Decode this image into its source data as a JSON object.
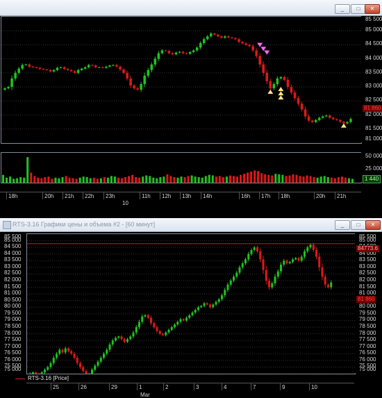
{
  "top_window": {
    "title": "",
    "buttons": [
      "_",
      "□",
      "✕"
    ],
    "price_ticks": [
      "85 500",
      "85 000",
      "84 500",
      "84 000",
      "83 500",
      "83 000",
      "82 500",
      "82 000",
      "81 500",
      "81 000"
    ],
    "price_badge": "81 860",
    "volume_ticks": [
      "50 000",
      "25 000"
    ],
    "volume_badge": "1 440",
    "time_labels": [
      "18h",
      "20h",
      "21h",
      "22h",
      "23h",
      "11h",
      "12h",
      "13h",
      "14h",
      "16h",
      "17h",
      "18h",
      "20h",
      "21h"
    ],
    "date_label": "10"
  },
  "bottom_window": {
    "title": "RTS-3.16 Графики цены и объема #2 - [60 минут]",
    "buttons": [
      "_",
      "□",
      "✕"
    ],
    "price_ticks": [
      "85 500",
      "85 000",
      "84 500",
      "84 000",
      "83 500",
      "83 000",
      "82 500",
      "82 000",
      "81 500",
      "81 000",
      "80 500",
      "80 000",
      "79 500",
      "79 000",
      "78 500",
      "78 000",
      "77 500",
      "77 000",
      "76 500",
      "76 000",
      "75 500",
      "75 000"
    ],
    "badge_high": "84773.6",
    "badge_last": "81 860",
    "legend": "RTS-3.16 [Price]",
    "time_labels": [
      "25",
      "26",
      "29",
      "1",
      "2",
      "3",
      "4",
      "7",
      "9",
      "10"
    ],
    "month_label": "Mar"
  },
  "colors": {
    "up": "#1fc41f",
    "down": "#e01818",
    "grid": "#333333",
    "hline": "#c02020",
    "pink": "#ff66ff",
    "yellow": "#ffe680",
    "badge_bg": "#7a0000"
  },
  "chart_data": [
    {
      "type": "candlestick",
      "title": "",
      "ylim": [
        81000,
        85500
      ],
      "y_ticks": [
        85500,
        85000,
        84500,
        84000,
        83500,
        83000,
        82500,
        82000,
        81500,
        81000
      ],
      "series": [
        {
          "values": [
            82900,
            82950,
            83000,
            83300,
            83500,
            83650,
            83780,
            83800,
            83720,
            83700,
            83680,
            83640,
            83620,
            83600,
            83550,
            83600,
            83680,
            83700,
            83640,
            83600,
            83560,
            83500,
            83600,
            83650,
            83700,
            83780,
            83760,
            83700,
            83700,
            83680,
            83720,
            83760,
            83780,
            83720,
            83620,
            83500,
            83300,
            83050,
            82950,
            82900,
            83100,
            83400,
            83600,
            83800,
            84000,
            84200,
            84300,
            84280,
            84200,
            84160,
            84220,
            84250,
            84200,
            84180,
            84240,
            84300,
            84400,
            84560,
            84700,
            84800,
            84900,
            84860,
            84800,
            84750,
            84800,
            84760,
            84740,
            84700,
            84600,
            84550,
            84500,
            84450,
            84300,
            84100,
            83800,
            83500,
            83200,
            82950,
            83100,
            83300,
            83350,
            83250,
            83000,
            82800,
            82600,
            82400,
            82200,
            81950,
            81800,
            81750,
            81820,
            81900,
            81950,
            81980,
            81900,
            81850,
            81820,
            81760,
            81700,
            81750,
            81860
          ]
        }
      ]
    },
    {
      "type": "bar",
      "title": "",
      "ylim": [
        0,
        50000
      ],
      "y_ticks": [
        50000,
        25000
      ],
      "values": [
        14000,
        9000,
        11000,
        7000,
        8000,
        10000,
        9000,
        46000,
        18000,
        12000,
        9000,
        8000,
        10000,
        11000,
        7000,
        9000,
        8000,
        10000,
        12000,
        9000,
        8000,
        7000,
        9000,
        11000,
        10000,
        8000,
        9000,
        7000,
        8000,
        10000,
        9000,
        12000,
        11000,
        9000,
        8000,
        10000,
        12000,
        14000,
        10000,
        9000,
        11000,
        13000,
        12000,
        9000,
        8000,
        10000,
        11000,
        15000,
        12000,
        10000,
        9000,
        11000,
        10000,
        12000,
        13000,
        11000,
        10000,
        9000,
        12000,
        14000,
        13000,
        11000,
        12000,
        10000,
        11000,
        13000,
        12000,
        11000,
        14000,
        16000,
        18000,
        20000,
        22000,
        21000,
        17000,
        15000,
        14000,
        13000,
        16000,
        15000,
        14000,
        12000,
        13000,
        15000,
        14000,
        12000,
        11000,
        13000,
        12000,
        10000,
        9000,
        11000,
        12000,
        10000,
        9000,
        8000,
        10000,
        11000,
        9000,
        8000,
        7000
      ]
    },
    {
      "type": "candlestick",
      "title": "",
      "ylim": [
        75000,
        85500
      ],
      "y_ticks": [
        85500,
        85000,
        84500,
        84000,
        83500,
        83000,
        82500,
        82000,
        81500,
        81000,
        80500,
        80000,
        79500,
        79000,
        78500,
        78000,
        77500,
        77000,
        76500,
        76000,
        75500,
        75000
      ],
      "hline": 84773.6,
      "series": [
        {
          "name": "RTS-3.16 [Price]",
          "values": [
            74800,
            75000,
            75100,
            75000,
            74900,
            75100,
            75300,
            75500,
            75800,
            76200,
            76500,
            76800,
            76600,
            76900,
            76700,
            76500,
            76200,
            75800,
            75500,
            75200,
            74900,
            75000,
            75300,
            75600,
            75900,
            76200,
            76500,
            76800,
            77200,
            77500,
            77700,
            77800,
            77600,
            77400,
            77600,
            77800,
            78100,
            78500,
            78900,
            79300,
            79400,
            79200,
            78800,
            78500,
            78200,
            78000,
            77900,
            78100,
            78300,
            78500,
            78700,
            78900,
            79100,
            79000,
            79200,
            79400,
            79600,
            79800,
            80000,
            80100,
            80300,
            80200,
            80000,
            80200,
            80400,
            80600,
            80900,
            81300,
            81700,
            82000,
            82300,
            82600,
            83000,
            83300,
            83600,
            84000,
            84300,
            84500,
            84200,
            83600,
            82800,
            82000,
            81500,
            81800,
            82300,
            82700,
            83200,
            83500,
            83300,
            83400,
            83600,
            83700,
            83500,
            83800,
            84200,
            84500,
            84700,
            84300,
            83800,
            83000,
            82300,
            81700,
            81500,
            81860
          ]
        }
      ]
    }
  ]
}
